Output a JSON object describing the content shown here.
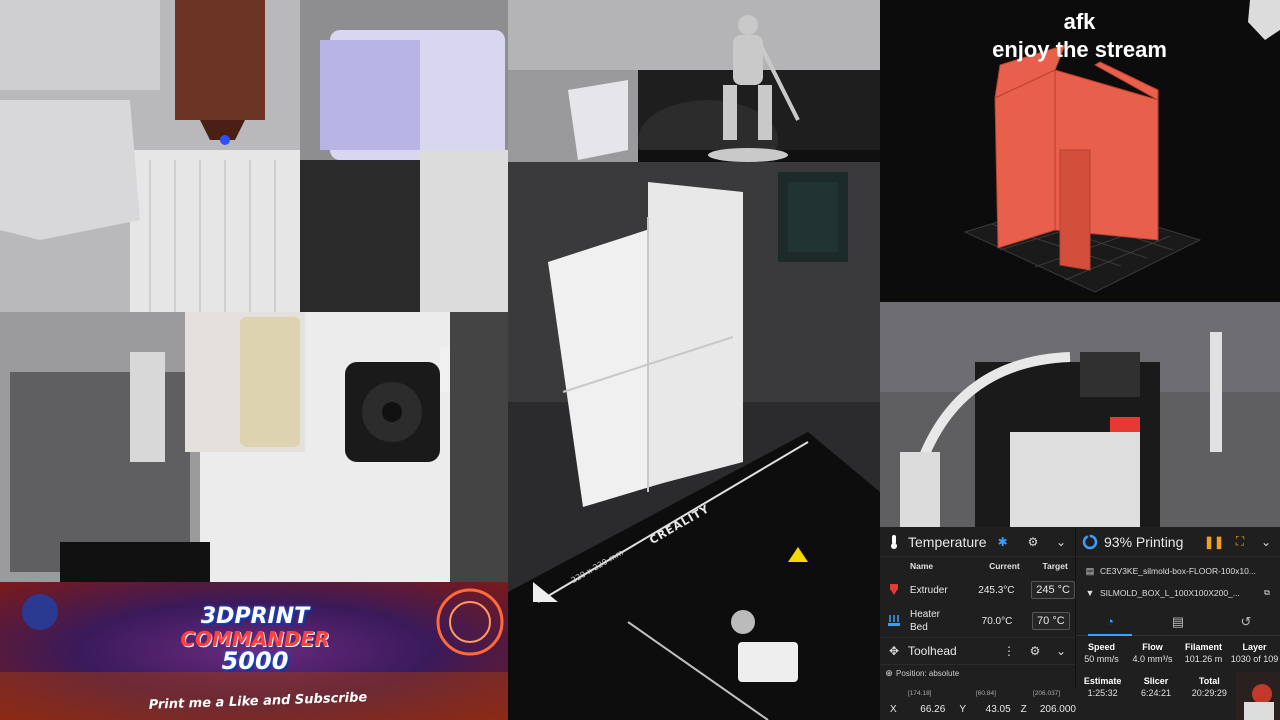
{
  "overlay": {
    "afk_line1": "afk",
    "afk_line2": "enjoy the stream"
  },
  "banner": {
    "logo_line1": "3DPRINT",
    "logo_line2": "COMMANDER",
    "logo_line3": "5000",
    "tagline": "Print me a Like and Subscribe"
  },
  "bed_marks": {
    "brand": "CREALITY",
    "size": "220 x 220 mm"
  },
  "temperature_panel": {
    "title": "Temperature",
    "col_name": "Name",
    "col_current": "Current",
    "col_target": "Target",
    "rows": [
      {
        "name": "Extruder",
        "current": "245.3°C",
        "target": "245",
        "unit": "°C"
      },
      {
        "name_line1": "Heater",
        "name_line2": "Bed",
        "current": "70.0°C",
        "target": "70",
        "unit": "°C"
      }
    ]
  },
  "toolhead_panel": {
    "title": "Toolhead",
    "position_mode": "Position: absolute",
    "default_label": "default",
    "axes": [
      {
        "axis": "X",
        "max": "[174.18]",
        "value": "66.26"
      },
      {
        "axis": "Y",
        "max": "[60.84]",
        "value": "43.05"
      },
      {
        "axis": "Z",
        "max": "[206.037]",
        "value": "206.000"
      }
    ]
  },
  "status_panel": {
    "title": "93% Printing",
    "progress_percent": 93,
    "files": [
      "CE3V3KE_silmold-box-FLOOR-100x10...",
      "SILMOLD_BOX_L_100X100X200_..."
    ],
    "stats_row1": [
      {
        "label": "Speed",
        "value": "50 mm/s"
      },
      {
        "label": "Flow",
        "value": "4.0 mm³/s"
      },
      {
        "label": "Filament",
        "value": "101.26 m"
      },
      {
        "label": "Layer",
        "value": "1030 of 109"
      }
    ],
    "stats_row2": [
      {
        "label": "Estimate",
        "value": "1:25:32"
      },
      {
        "label": "Slicer",
        "value": "6:24:21"
      },
      {
        "label": "Total",
        "value": "20:29:29"
      }
    ]
  },
  "colors": {
    "panel_bg": "#1f1f1f",
    "accent_blue": "#3aa0ff",
    "pause_orange": "#f0a020",
    "model_red": "#e8604c",
    "error_red": "#e53935"
  }
}
